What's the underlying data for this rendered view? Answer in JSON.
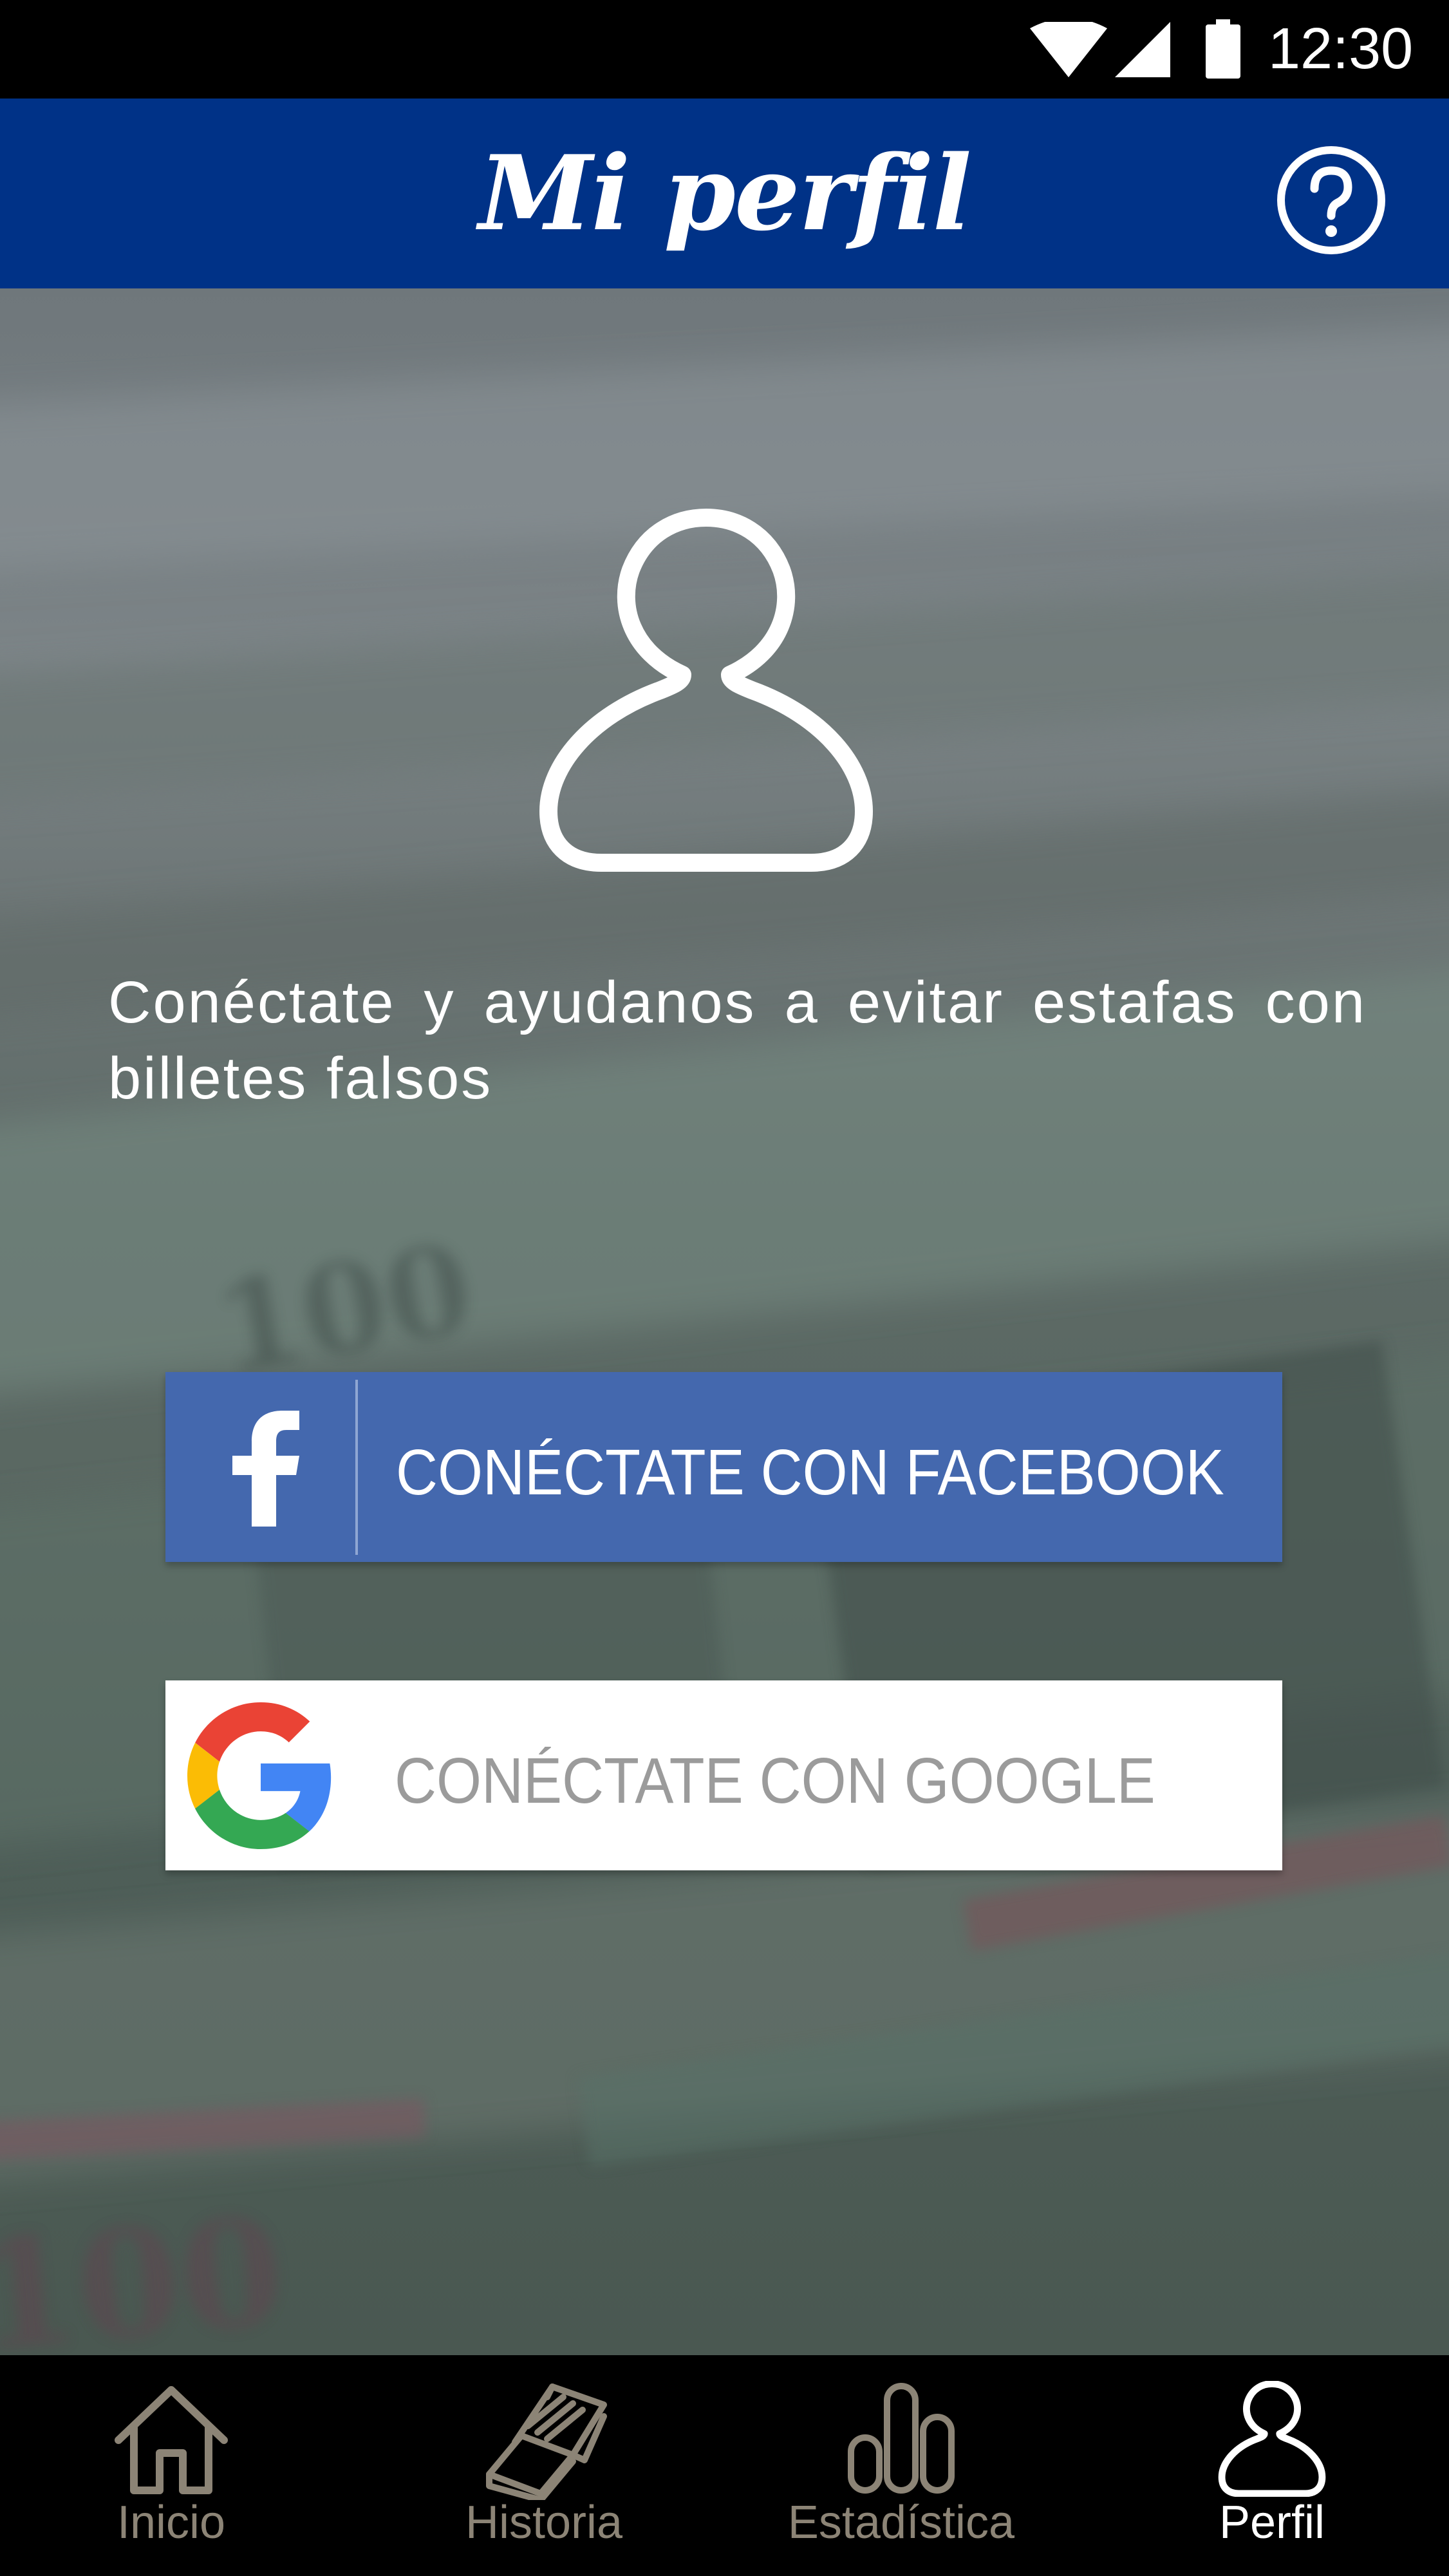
{
  "status_bar": {
    "time": "12:30",
    "icons": [
      "wifi-icon",
      "cellular-signal-icon",
      "battery-icon"
    ]
  },
  "header": {
    "title": "Mi perfil",
    "help_icon": "question-circle-icon"
  },
  "main": {
    "avatar_icon": "user-outline-icon",
    "intro_text": "Conéctate y ayudanos a evitar estafas con billetes falsos",
    "facebook_button": {
      "label": "CONÉCTATE CON FACEBOOK",
      "icon": "facebook-icon"
    },
    "google_button": {
      "label": "CONÉCTATE CON GOOGLE",
      "icon": "google-icon"
    }
  },
  "bottom_nav": {
    "items": [
      {
        "label": "Inicio",
        "icon": "home-icon",
        "active": false
      },
      {
        "label": "Historia",
        "icon": "book-icon",
        "active": false
      },
      {
        "label": "Estadística",
        "icon": "bar-chart-icon",
        "active": false
      },
      {
        "label": "Perfil",
        "icon": "user-icon",
        "active": true
      }
    ]
  },
  "colors": {
    "header_bg": "#003287",
    "facebook_blue": "#4468ae",
    "nav_inactive": "#8c8476",
    "nav_active": "#ffffff"
  }
}
